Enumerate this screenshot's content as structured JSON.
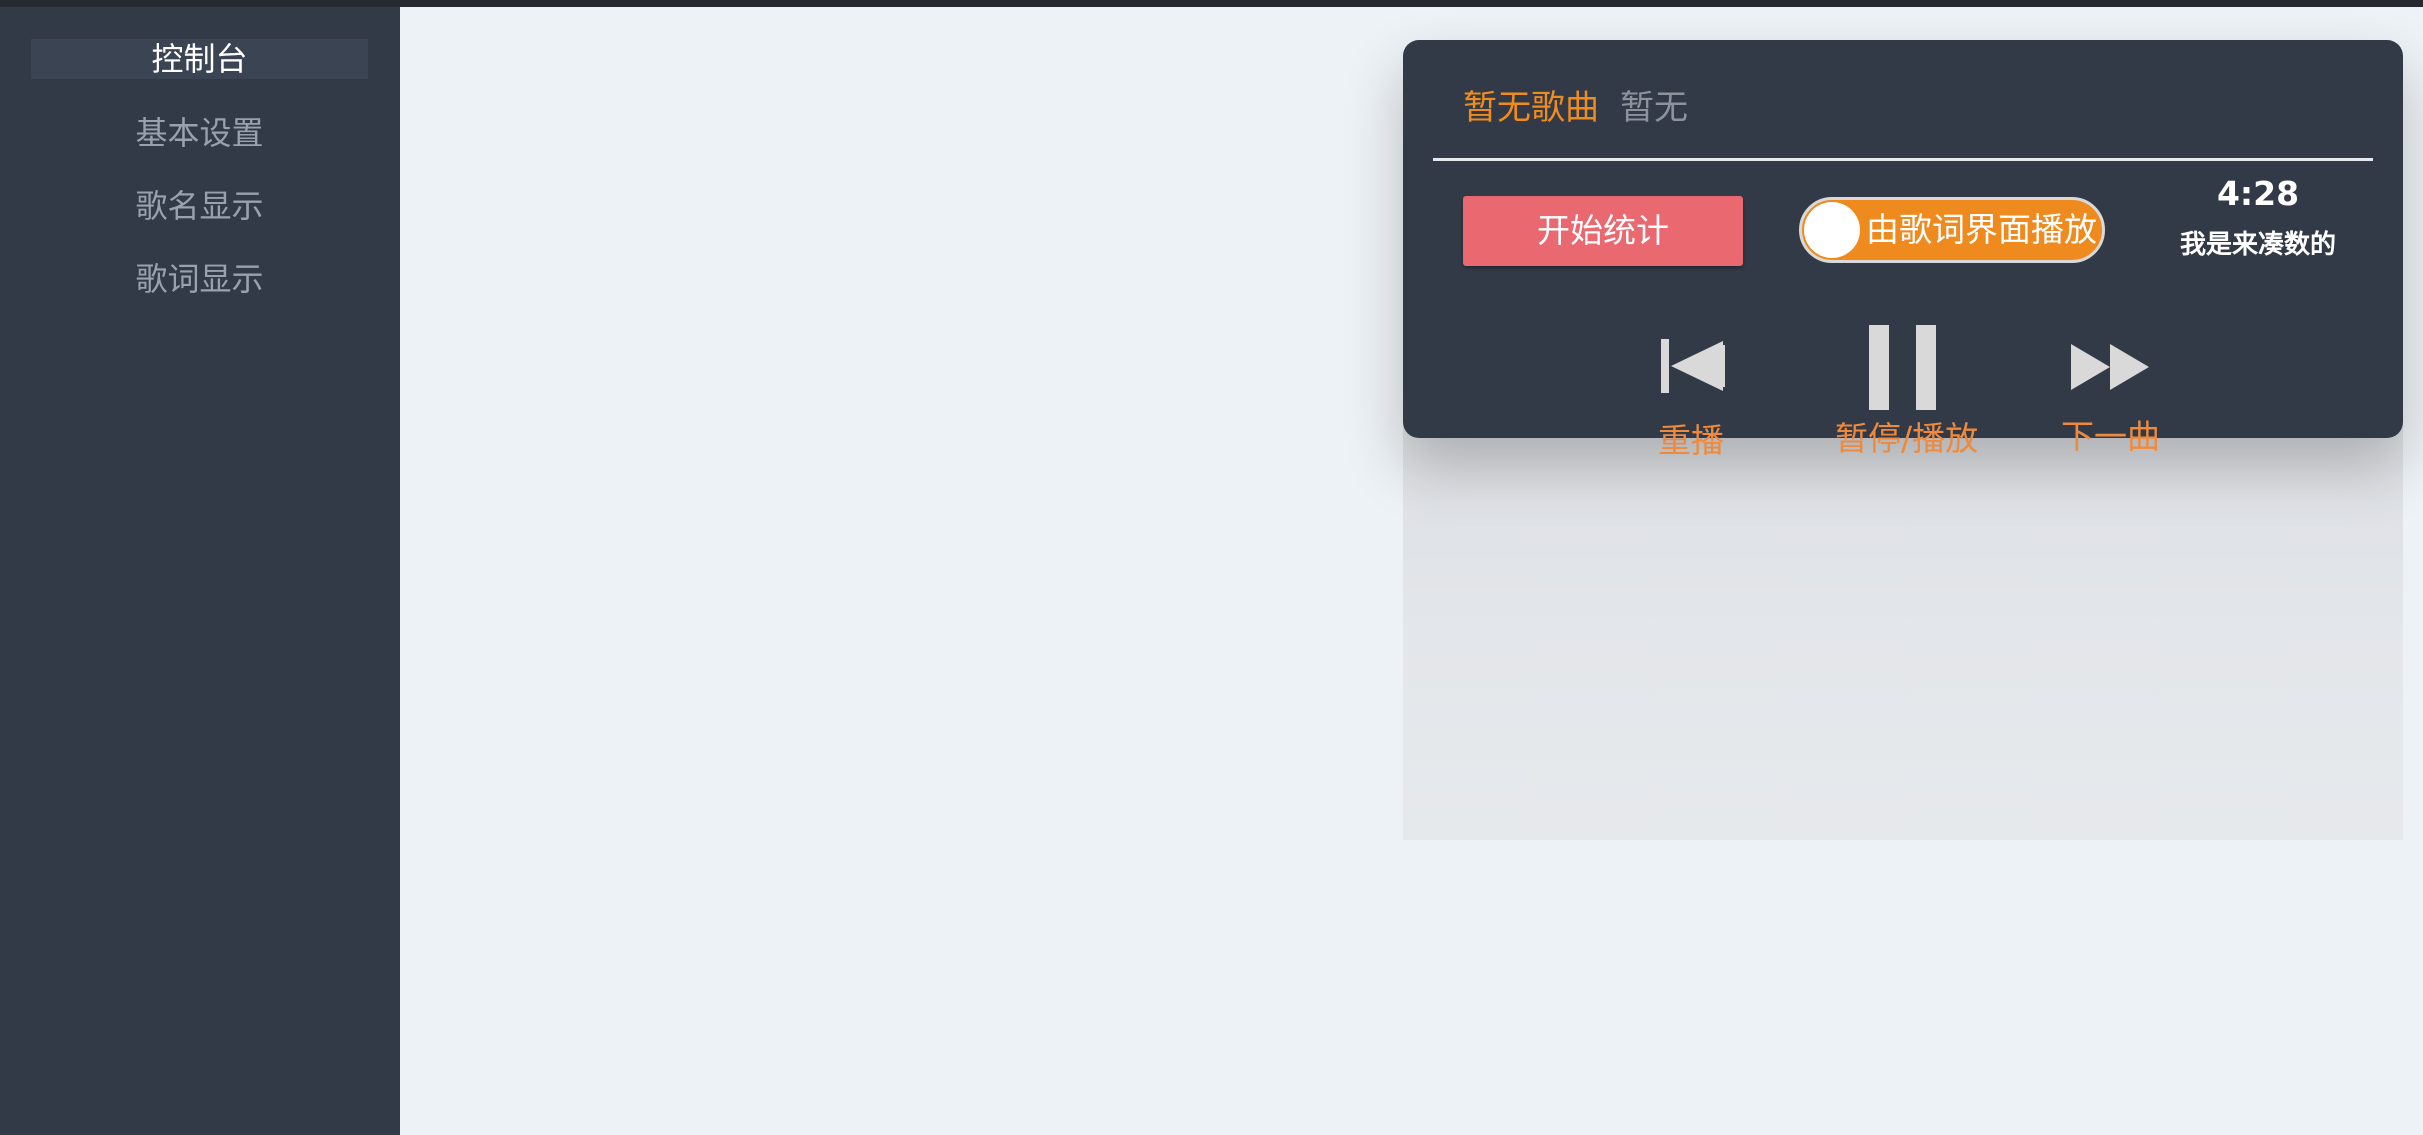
{
  "sidebar": {
    "items": [
      {
        "label": "控制台",
        "active": true
      },
      {
        "label": "基本设置",
        "active": false
      },
      {
        "label": "歌名显示",
        "active": false
      },
      {
        "label": "歌词显示",
        "active": false
      }
    ]
  },
  "player": {
    "song_title": "暂无歌曲",
    "artist": "暂无",
    "stat_button_label": "开始统计",
    "toggle_label": "由歌词界面播放",
    "toggle_on": true,
    "time": "4:28",
    "time_sub": "我是来凑数的",
    "controls": {
      "replay": {
        "label": "重播",
        "icon": "skip-previous-icon"
      },
      "pause_play": {
        "label": "暂停/播放",
        "icon": "pause-icon"
      },
      "next": {
        "label": "下一曲",
        "icon": "fast-forward-icon"
      }
    }
  },
  "colors": {
    "accent_orange": "#ef8a1f",
    "button_red": "#ea6870",
    "sidebar_bg": "#323a47",
    "player_bg": "#323a48",
    "page_bg": "#edf2f6"
  }
}
